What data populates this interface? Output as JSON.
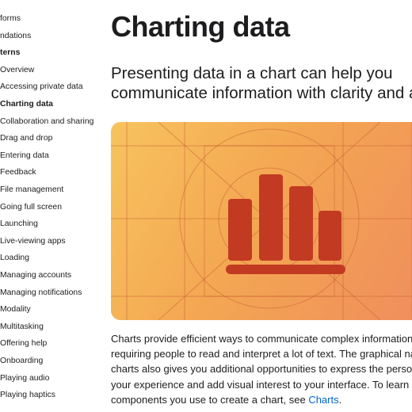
{
  "sidebar": {
    "items": [
      {
        "label": "forms",
        "kind": "item"
      },
      {
        "label": "ndations",
        "kind": "item"
      },
      {
        "label": "terns",
        "kind": "section"
      },
      {
        "label": "Overview",
        "kind": "item"
      },
      {
        "label": "Accessing private data",
        "kind": "item"
      },
      {
        "label": "Charting data",
        "kind": "active"
      },
      {
        "label": "Collaboration and sharing",
        "kind": "item"
      },
      {
        "label": "Drag and drop",
        "kind": "item"
      },
      {
        "label": "Entering data",
        "kind": "item"
      },
      {
        "label": "Feedback",
        "kind": "item"
      },
      {
        "label": "File management",
        "kind": "item"
      },
      {
        "label": "Going full screen",
        "kind": "item"
      },
      {
        "label": "Launching",
        "kind": "item"
      },
      {
        "label": "Live-viewing apps",
        "kind": "item"
      },
      {
        "label": "Loading",
        "kind": "item"
      },
      {
        "label": "Managing accounts",
        "kind": "item"
      },
      {
        "label": "Managing notifications",
        "kind": "item"
      },
      {
        "label": "Modality",
        "kind": "item"
      },
      {
        "label": "Multitasking",
        "kind": "item"
      },
      {
        "label": "Offering help",
        "kind": "item"
      },
      {
        "label": "Onboarding",
        "kind": "item"
      },
      {
        "label": "Playing audio",
        "kind": "item"
      },
      {
        "label": "Playing haptics",
        "kind": "item"
      }
    ]
  },
  "main": {
    "title": "Charting data",
    "lead_lines": [
      "Presenting data in a chart can help you",
      "communicate information with clarity and a"
    ],
    "hero": {
      "icon": "bar-chart-icon",
      "colors": {
        "gradient_start": "#f7c35f",
        "gradient_end": "#ef8d5d",
        "bars": "#c23a22"
      }
    },
    "body_lines": [
      "Charts provide efficient ways to communicate complex information",
      "requiring people to read and interpret a lot of text. The graphical na",
      "charts also gives you additional opportunities to express the persor",
      "your experience and add visual interest to your interface. To learn a"
    ],
    "body_last_prefix": "components you use to create a chart, see ",
    "body_link": "Charts",
    "body_last_suffix": "."
  }
}
